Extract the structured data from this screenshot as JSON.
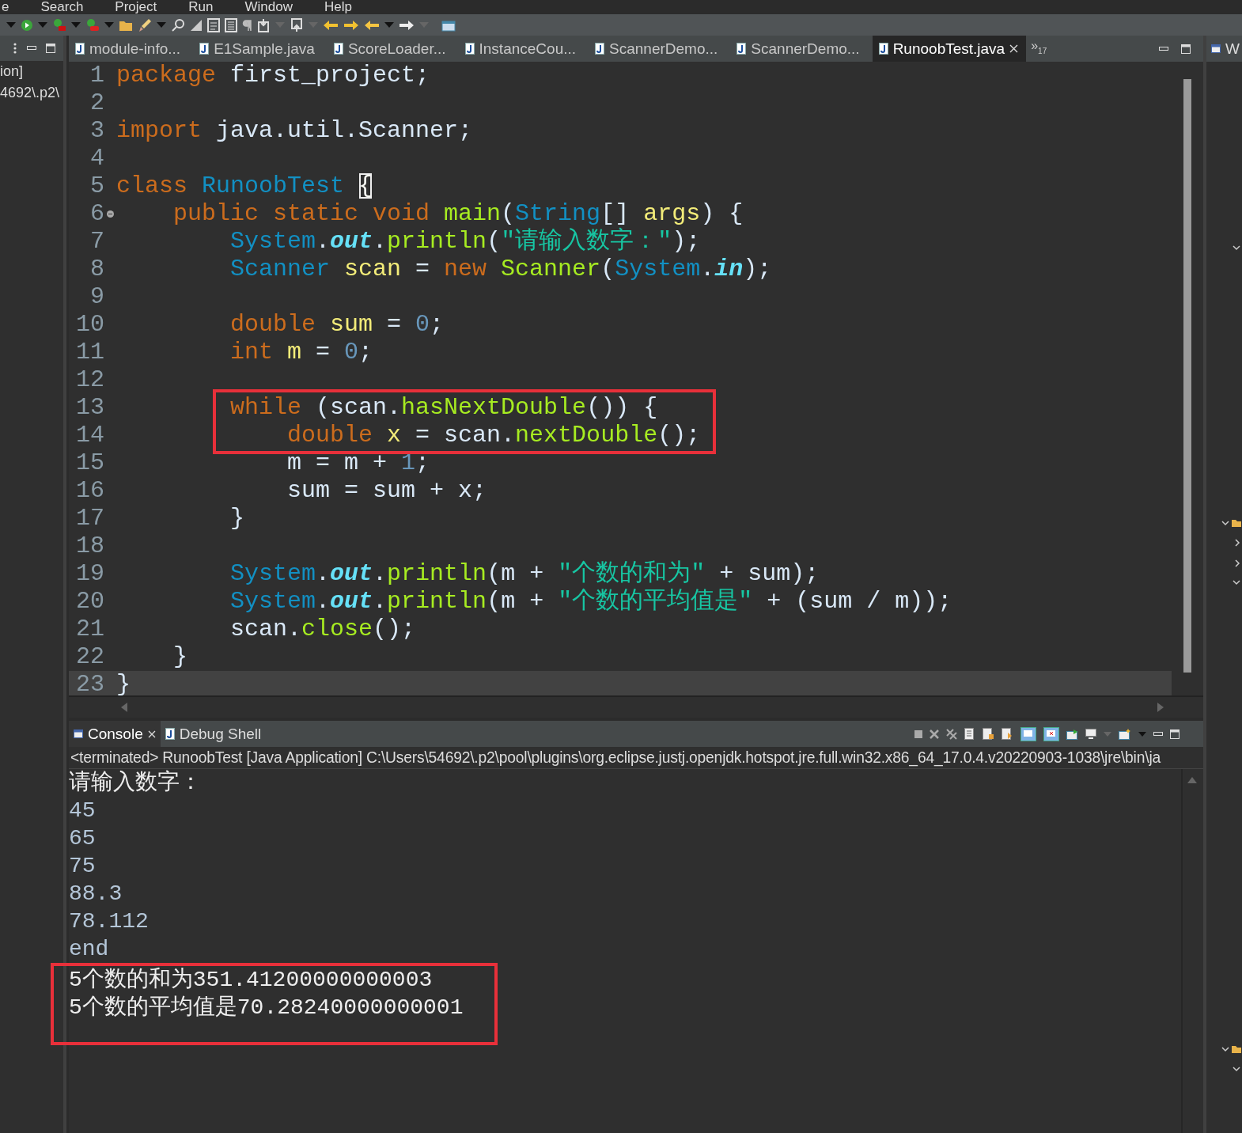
{
  "menu": [
    "e",
    "Search",
    "Project",
    "Run",
    "Window",
    "Help"
  ],
  "left_panel": {
    "lines": [
      "ion]",
      "4692\\.p2\\"
    ]
  },
  "editor_tabs": [
    {
      "label": "module-info...",
      "selected": false
    },
    {
      "label": "E1Sample.java",
      "selected": false
    },
    {
      "label": "ScoreLoader...",
      "selected": false
    },
    {
      "label": "InstanceCou...",
      "selected": false
    },
    {
      "label": "ScannerDemo...",
      "selected": false
    },
    {
      "label": "ScannerDemo...",
      "selected": false
    },
    {
      "label": "RunoobTest.java",
      "selected": true
    }
  ],
  "tab_overflow": {
    "symbol": "»",
    "count": "17"
  },
  "right_panel": {
    "tab": "W"
  },
  "code_lines": [
    {
      "number": "1",
      "boxed": false,
      "current": false,
      "fold": false,
      "tokens": [
        {
          "kind": "kw",
          "text": "package"
        },
        {
          "kind": "plain",
          "text": " first_project;"
        }
      ]
    },
    {
      "number": "2",
      "boxed": false,
      "current": false,
      "fold": false
    },
    {
      "number": "3",
      "boxed": false,
      "current": false,
      "fold": false,
      "tokens": [
        {
          "kind": "kw",
          "text": "import"
        },
        {
          "kind": "plain",
          "text": " java.util.Scanner;"
        }
      ]
    },
    {
      "number": "4",
      "boxed": false,
      "current": false,
      "fold": false
    },
    {
      "number": "5",
      "boxed": false,
      "current": false,
      "fold": false,
      "tokens": [
        {
          "kind": "kw",
          "text": "class"
        },
        {
          "kind": "type",
          "text": " RunoobTest "
        },
        {
          "kind": "bracket",
          "text": "{"
        }
      ]
    },
    {
      "number": "6",
      "boxed": false,
      "current": false,
      "fold": true,
      "tokens": [
        {
          "kind": "kw",
          "text": "    public static void"
        },
        {
          "kind": "method",
          "text": " main"
        },
        {
          "kind": "plain",
          "text": "("
        },
        {
          "kind": "type",
          "text": "String"
        },
        {
          "kind": "plain",
          "text": "[] "
        },
        {
          "kind": "var",
          "text": "args"
        },
        {
          "kind": "plain",
          "text": ") {"
        }
      ]
    },
    {
      "number": "7",
      "boxed": false,
      "current": false,
      "fold": false,
      "tokens": [
        {
          "kind": "type",
          "text": "        System"
        },
        {
          "kind": "plain",
          "text": "."
        },
        {
          "kind": "field",
          "text": "out"
        },
        {
          "kind": "plain",
          "text": "."
        },
        {
          "kind": "method",
          "text": "println"
        },
        {
          "kind": "plain",
          "text": "("
        },
        {
          "kind": "string",
          "text": "\"请输入数字：\""
        },
        {
          "kind": "plain",
          "text": ");"
        }
      ]
    },
    {
      "number": "8",
      "boxed": false,
      "current": false,
      "fold": false,
      "tokens": [
        {
          "kind": "type",
          "text": "        Scanner"
        },
        {
          "kind": "var",
          "text": " scan"
        },
        {
          "kind": "plain",
          "text": " = "
        },
        {
          "kind": "kw",
          "text": "new"
        },
        {
          "kind": "method",
          "text": " Scanner"
        },
        {
          "kind": "plain",
          "text": "("
        },
        {
          "kind": "type",
          "text": "System"
        },
        {
          "kind": "plain",
          "text": "."
        },
        {
          "kind": "field",
          "text": "in"
        },
        {
          "kind": "plain",
          "text": ");"
        }
      ]
    },
    {
      "number": "9",
      "boxed": false,
      "current": false,
      "fold": false
    },
    {
      "number": "10",
      "boxed": false,
      "current": false,
      "fold": false,
      "tokens": [
        {
          "kind": "kw",
          "text": "        double"
        },
        {
          "kind": "var",
          "text": " sum"
        },
        {
          "kind": "plain",
          "text": " = "
        },
        {
          "kind": "num",
          "text": "0"
        },
        {
          "kind": "plain",
          "text": ";"
        }
      ]
    },
    {
      "number": "11",
      "boxed": false,
      "current": false,
      "fold": false,
      "tokens": [
        {
          "kind": "kw",
          "text": "        int"
        },
        {
          "kind": "var",
          "text": " m"
        },
        {
          "kind": "plain",
          "text": " = "
        },
        {
          "kind": "num",
          "text": "0"
        },
        {
          "kind": "plain",
          "text": ";"
        }
      ]
    },
    {
      "number": "12",
      "boxed": false,
      "current": false,
      "fold": false
    },
    {
      "number": "13",
      "boxed": true,
      "current": false,
      "fold": false,
      "tokens": [
        {
          "kind": "kw",
          "text": "        while"
        },
        {
          "kind": "plain",
          "text": " (scan."
        },
        {
          "kind": "method",
          "text": "hasNextDouble"
        },
        {
          "kind": "plain",
          "text": "()) {"
        }
      ]
    },
    {
      "number": "14",
      "boxed": true,
      "current": false,
      "fold": false,
      "tokens": [
        {
          "kind": "kw",
          "text": "            double"
        },
        {
          "kind": "var",
          "text": " x"
        },
        {
          "kind": "plain",
          "text": " = scan."
        },
        {
          "kind": "method",
          "text": "nextDouble"
        },
        {
          "kind": "plain",
          "text": "();"
        }
      ]
    },
    {
      "number": "15",
      "boxed": false,
      "current": false,
      "fold": false,
      "tokens": [
        {
          "kind": "plain",
          "text": "            m = m + "
        },
        {
          "kind": "num",
          "text": "1"
        },
        {
          "kind": "plain",
          "text": ";"
        }
      ]
    },
    {
      "number": "16",
      "boxed": false,
      "current": false,
      "fold": false,
      "tokens": [
        {
          "kind": "plain",
          "text": "            sum = sum + x;"
        }
      ]
    },
    {
      "number": "17",
      "boxed": false,
      "current": false,
      "fold": false,
      "tokens": [
        {
          "kind": "plain",
          "text": "        }"
        }
      ]
    },
    {
      "number": "18",
      "boxed": false,
      "current": false,
      "fold": false
    },
    {
      "number": "19",
      "boxed": false,
      "current": false,
      "fold": false,
      "tokens": [
        {
          "kind": "type",
          "text": "        System"
        },
        {
          "kind": "plain",
          "text": "."
        },
        {
          "kind": "field",
          "text": "out"
        },
        {
          "kind": "plain",
          "text": "."
        },
        {
          "kind": "method",
          "text": "println"
        },
        {
          "kind": "plain",
          "text": "(m + "
        },
        {
          "kind": "string",
          "text": "\"个数的和为\""
        },
        {
          "kind": "plain",
          "text": " + sum);"
        }
      ]
    },
    {
      "number": "20",
      "boxed": false,
      "current": false,
      "fold": false,
      "tokens": [
        {
          "kind": "type",
          "text": "        System"
        },
        {
          "kind": "plain",
          "text": "."
        },
        {
          "kind": "field",
          "text": "out"
        },
        {
          "kind": "plain",
          "text": "."
        },
        {
          "kind": "method",
          "text": "println"
        },
        {
          "kind": "plain",
          "text": "(m + "
        },
        {
          "kind": "string",
          "text": "\"个数的平均值是\""
        },
        {
          "kind": "plain",
          "text": " + (sum / m));"
        }
      ]
    },
    {
      "number": "21",
      "boxed": false,
      "current": false,
      "fold": false,
      "tokens": [
        {
          "kind": "plain",
          "text": "        scan."
        },
        {
          "kind": "method",
          "text": "close"
        },
        {
          "kind": "plain",
          "text": "();"
        }
      ]
    },
    {
      "number": "22",
      "boxed": false,
      "current": false,
      "fold": false,
      "tokens": [
        {
          "kind": "plain",
          "text": "    }"
        }
      ]
    },
    {
      "number": "23",
      "boxed": false,
      "current": true,
      "fold": false,
      "tokens": [
        {
          "kind": "plain",
          "text": "}"
        }
      ]
    }
  ],
  "console": {
    "tabs": [
      {
        "label": "Console",
        "selected": true,
        "closable": true
      },
      {
        "label": "Debug Shell",
        "selected": false,
        "closable": false
      }
    ],
    "header": "<terminated> RunoobTest [Java Application] C:\\Users\\54692\\.p2\\pool\\plugins\\org.eclipse.justj.openjdk.hotspot.jre.full.win32.x86_64_17.0.4.v20220903-1038\\jre\\bin\\ja",
    "lines": [
      {
        "kind": "output",
        "text": "请输入数字：",
        "boxed": false
      },
      {
        "kind": "input",
        "text": "45",
        "boxed": false
      },
      {
        "kind": "input",
        "text": "65",
        "boxed": false
      },
      {
        "kind": "input",
        "text": "75",
        "boxed": false
      },
      {
        "kind": "input",
        "text": "88.3",
        "boxed": false
      },
      {
        "kind": "input",
        "text": "78.112",
        "boxed": false
      },
      {
        "kind": "input",
        "text": "end",
        "boxed": false
      },
      {
        "kind": "output",
        "text": "5个数的和为351.41200000000003",
        "boxed": true
      },
      {
        "kind": "output",
        "text": "5个数的平均值是70.28240000000001",
        "boxed": true
      }
    ]
  }
}
